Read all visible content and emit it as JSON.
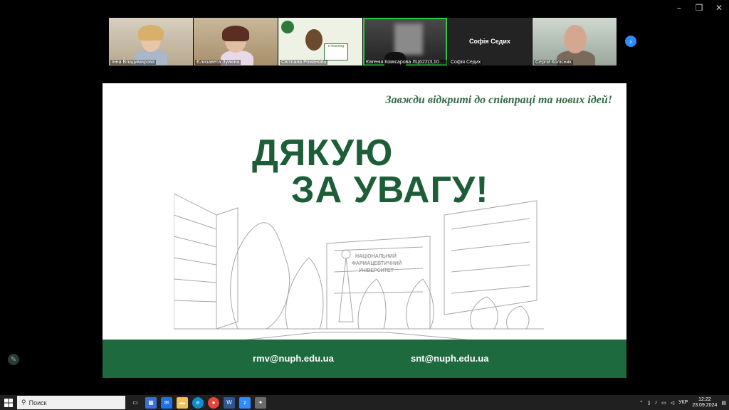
{
  "window_controls": {
    "minimize": "–",
    "restore": "❐",
    "close": "✕"
  },
  "participants": [
    {
      "name": "Інна Владимирова"
    },
    {
      "name": "Єлизавета Зуйкіна"
    },
    {
      "name": "Світлана Романова",
      "logo_text": "e-learning"
    },
    {
      "name": "Євгенія Комісарова ЛЦб22(3,10д)..."
    },
    {
      "name": "Софія Седих",
      "display_name": "Софія Седих"
    },
    {
      "name": "Сергій Колісник"
    }
  ],
  "strip_next_icon": "chevron-right-icon",
  "slide": {
    "slogan": "Завжди відкриті до співпраці та нових ідей!",
    "title_line1": "ДЯКУЮ",
    "title_line2": "ЗА УВАГУ!",
    "building_sign": [
      "НАЦІОНАЛЬНИЙ",
      "ФАРМАЦЕВТИЧНИЙ",
      "УНІВЕРСИТЕТ"
    ],
    "email1": "rmv@nuph.edu.ua",
    "email2": "snt@nuph.edu.ua",
    "colors": {
      "brand_green": "#1d6a3e",
      "title_green": "#1d5e38"
    }
  },
  "taskbar": {
    "search_placeholder": "Поиск",
    "language": "УКР",
    "time": "12:22",
    "date": "23.09.2024",
    "apps": [
      "task-view-icon",
      "store-icon",
      "mail-icon",
      "file-explorer-icon",
      "edge-icon",
      "chrome-icon",
      "word-icon",
      "zoom-icon",
      "paint-icon"
    ]
  }
}
